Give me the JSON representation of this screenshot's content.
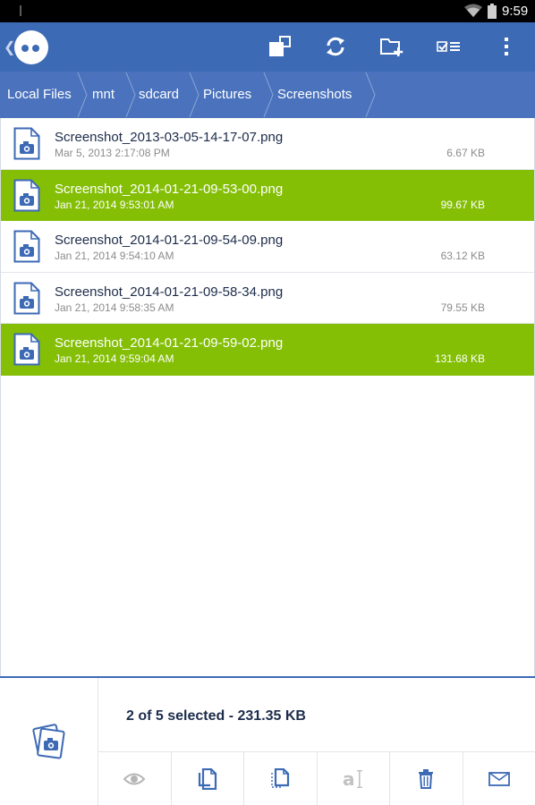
{
  "status_bar": {
    "time": "9:59"
  },
  "action_bar": {
    "icons": [
      "window-icon",
      "sync-icon",
      "new-folder-icon",
      "select-list-icon",
      "overflow-icon"
    ]
  },
  "breadcrumb": [
    {
      "label": "Local Files"
    },
    {
      "label": "mnt"
    },
    {
      "label": "sdcard"
    },
    {
      "label": "Pictures"
    },
    {
      "label": "Screenshots"
    }
  ],
  "files": [
    {
      "name": "Screenshot_2013-03-05-14-17-07.png",
      "date": "Mar 5, 2013 2:17:08 PM",
      "size": "6.67 KB",
      "selected": false
    },
    {
      "name": "Screenshot_2014-01-21-09-53-00.png",
      "date": "Jan 21, 2014 9:53:01 AM",
      "size": "99.67 KB",
      "selected": true
    },
    {
      "name": "Screenshot_2014-01-21-09-54-09.png",
      "date": "Jan 21, 2014 9:54:10 AM",
      "size": "63.12 KB",
      "selected": false
    },
    {
      "name": "Screenshot_2014-01-21-09-58-34.png",
      "date": "Jan 21, 2014 9:58:35 AM",
      "size": "79.55 KB",
      "selected": false
    },
    {
      "name": "Screenshot_2014-01-21-09-59-02.png",
      "date": "Jan 21, 2014 9:59:04 AM",
      "size": "131.68 KB",
      "selected": true
    }
  ],
  "selection": {
    "summary": "2 of 5 selected - 231.35 KB"
  },
  "toolbar": {
    "icons": [
      "eye-icon",
      "copy-icon",
      "cut-icon",
      "rename-icon",
      "delete-icon",
      "email-icon"
    ]
  },
  "colors": {
    "primary": "#3d6ab5",
    "breadcrumb_bg": "#4a72bd",
    "selected_row": "#84bf06",
    "text_dark": "#1d2c4a"
  }
}
